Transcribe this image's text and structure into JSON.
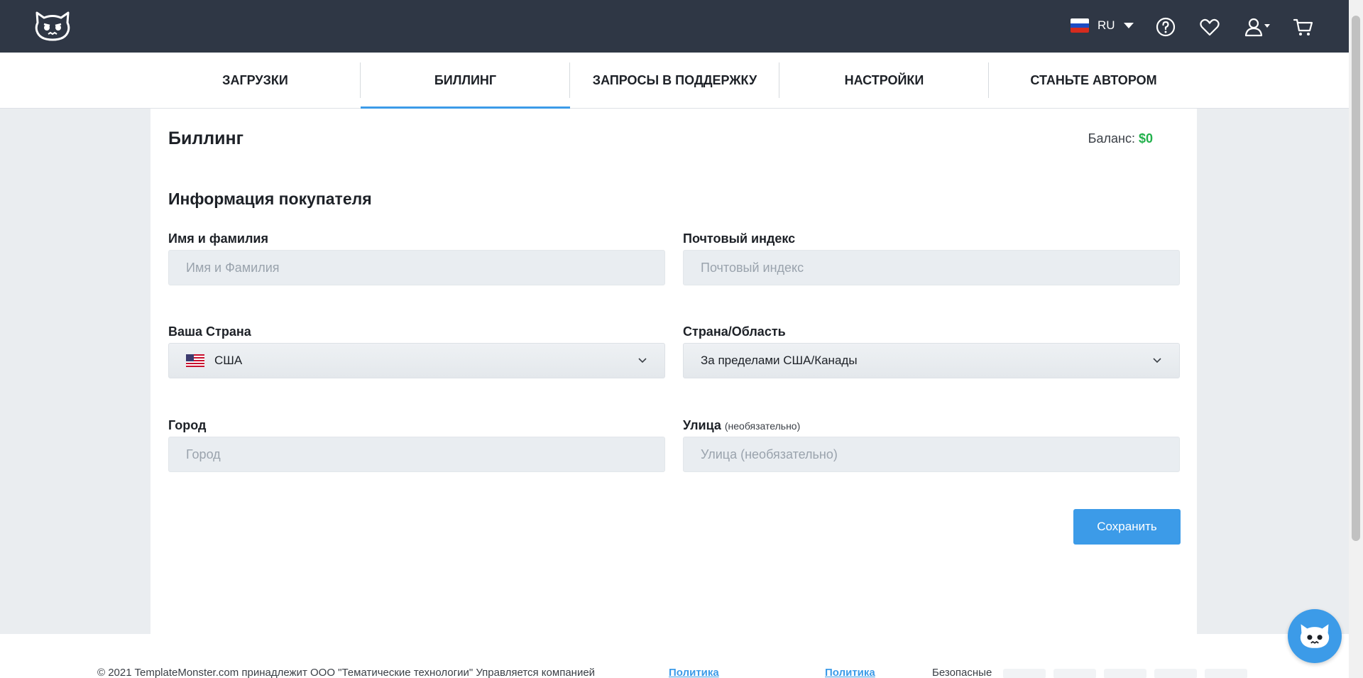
{
  "header": {
    "logo_icon": "templatemonster-logo-icon",
    "language": "RU",
    "icons": [
      "help-icon",
      "heart-icon",
      "user-icon",
      "cart-icon"
    ]
  },
  "tabs": [
    {
      "label": "ЗАГРУЗКИ",
      "active": false
    },
    {
      "label": "БИЛЛИНГ",
      "active": true
    },
    {
      "label": "ЗАПРОСЫ В ПОДДЕРЖКУ",
      "active": false
    },
    {
      "label": "НАСТРОЙКИ",
      "active": false
    },
    {
      "label": "СТАНЬТЕ АВТОРОМ",
      "active": false
    }
  ],
  "billing": {
    "title": "Биллинг",
    "balance_label": "Баланс:",
    "balance_value": "$0",
    "section_title": "Информация покупателя",
    "fields": {
      "name": {
        "label": "Имя и фамилия",
        "placeholder": "Имя и Фамилия",
        "value": ""
      },
      "zip": {
        "label": "Почтовый индекс",
        "placeholder": "Почтовый индекс",
        "value": ""
      },
      "country": {
        "label": "Ваша Страна",
        "value": "США"
      },
      "region": {
        "label": "Страна/Область",
        "value": "За пределами США/Канады"
      },
      "city": {
        "label": "Город",
        "placeholder": "Город",
        "value": ""
      },
      "street": {
        "label": "Улица",
        "label_optional": "(необязательно)",
        "placeholder": "Улица (необязательно)",
        "value": ""
      }
    },
    "save_label": "Сохранить"
  },
  "footer": {
    "copyright": "© 2021 TemplateMonster.com принадлежит ООО \"Тематические технологии\" Управляется компанией",
    "link1": "Политика",
    "link2": "Политика",
    "safe_label": "Безопасные"
  },
  "colors": {
    "topbar": "#2f3745",
    "accent": "#3c9be8",
    "balance": "#22b14c"
  }
}
